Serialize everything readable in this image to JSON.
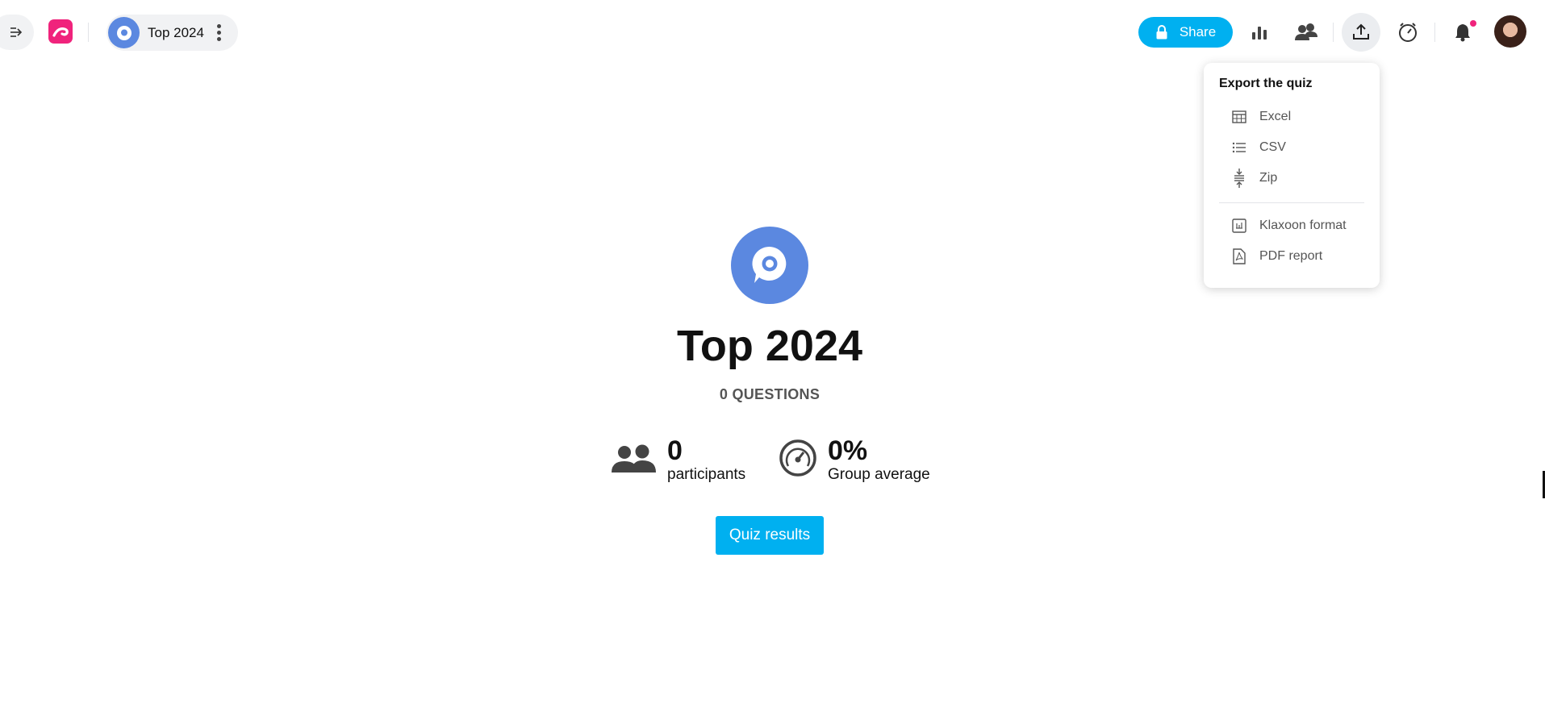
{
  "topbar": {
    "quiz_title": "Top 2024",
    "share_label": "Share"
  },
  "export_menu": {
    "title": "Export the quiz",
    "items": [
      {
        "label": "Excel",
        "icon": "table-icon"
      },
      {
        "label": "CSV",
        "icon": "list-icon"
      },
      {
        "label": "Zip",
        "icon": "zip-icon"
      },
      {
        "label": "Klaxoon format",
        "icon": "klaxoon-file-icon"
      },
      {
        "label": "PDF report",
        "icon": "pdf-icon"
      }
    ]
  },
  "main": {
    "title": "Top 2024",
    "subtitle": "0 QUESTIONS",
    "participants": {
      "value": "0",
      "label": "participants"
    },
    "group_average": {
      "value": "0%",
      "label": "Group average"
    },
    "results_button": "Quiz results"
  },
  "colors": {
    "accent": "#00b0f0",
    "brand": "#f0237c",
    "quiz_avatar": "#5b88e0"
  }
}
